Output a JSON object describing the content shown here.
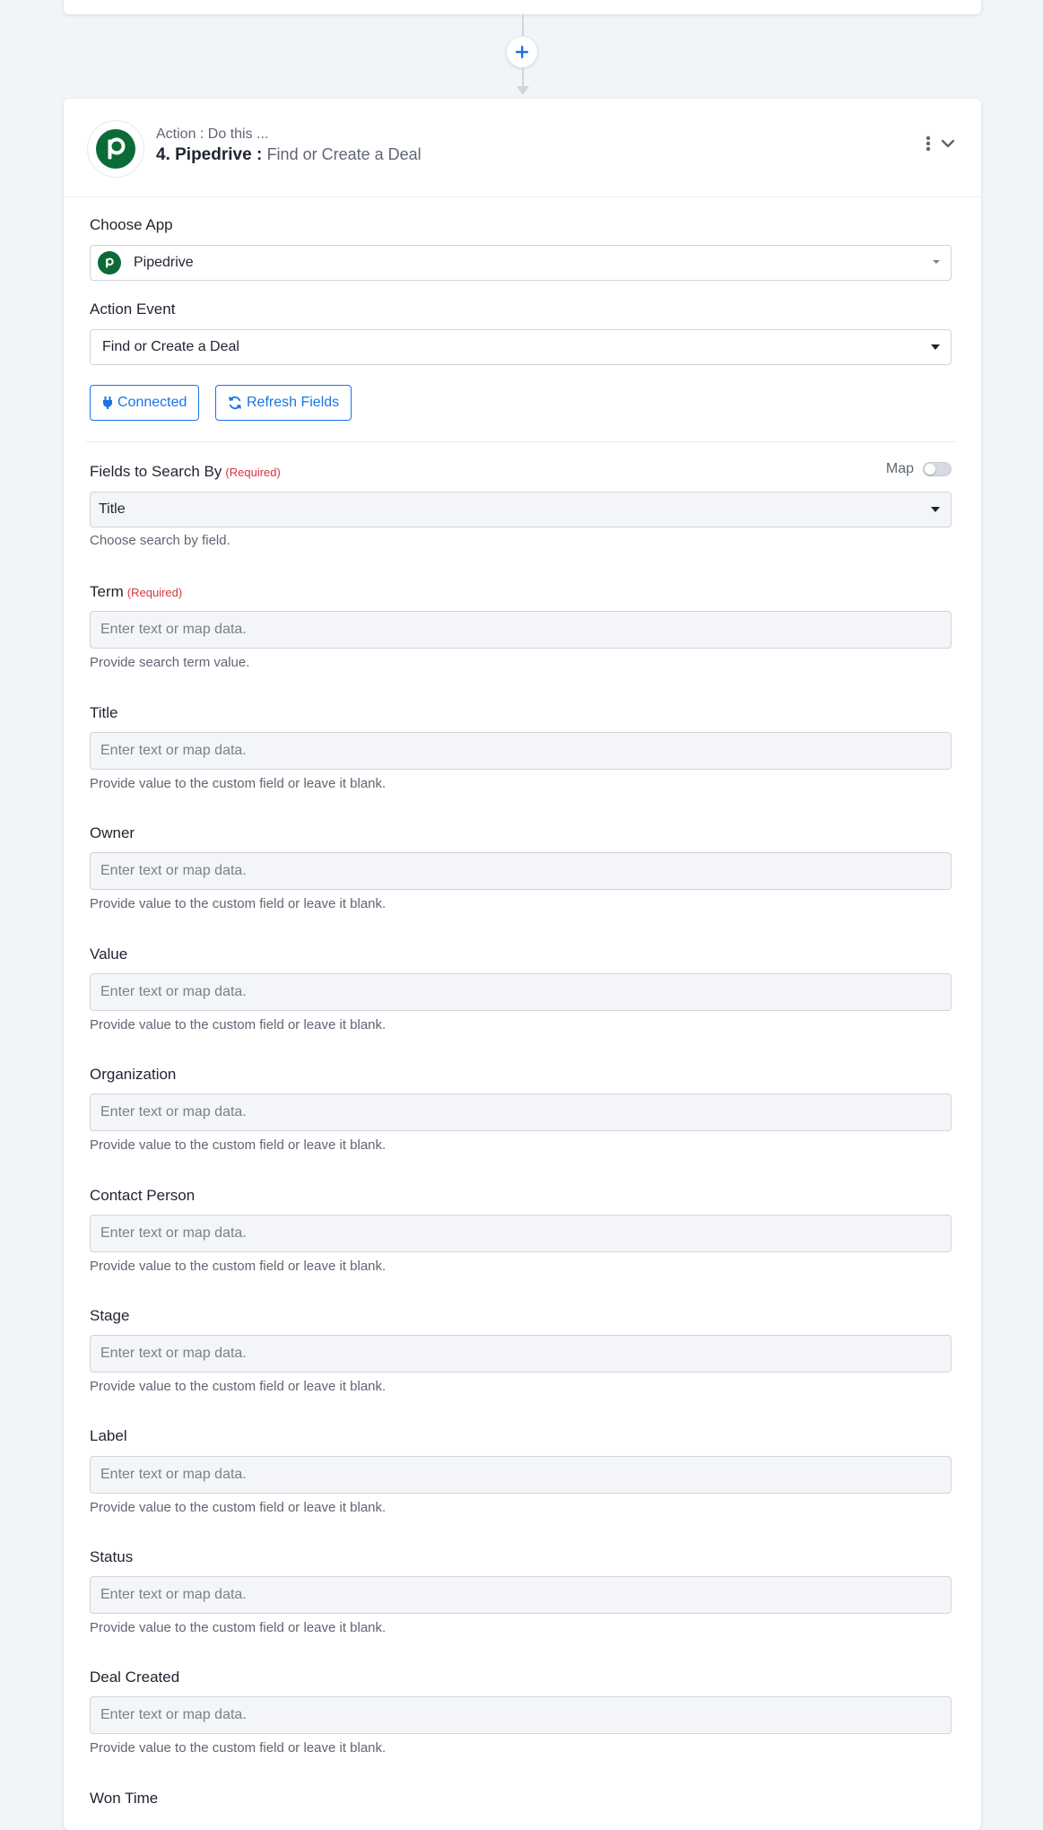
{
  "header": {
    "subtitle": "Action : Do this ...",
    "step": "4. Pipedrive :",
    "event": "Find or Create a Deal"
  },
  "choose_app": {
    "label": "Choose App",
    "value": "Pipedrive"
  },
  "action_event": {
    "label": "Action Event",
    "value": "Find or Create a Deal"
  },
  "buttons": {
    "connected": "Connected",
    "refresh": "Refresh Fields"
  },
  "search_by": {
    "label": "Fields to Search By",
    "required": "(Required)",
    "map_label": "Map",
    "value": "Title",
    "hint": "Choose search by field."
  },
  "term": {
    "label": "Term",
    "required": "(Required)",
    "placeholder": "Enter text or map data.",
    "hint": "Provide search term value."
  },
  "fields": [
    {
      "label": "Title",
      "placeholder": "Enter text or map data.",
      "hint": "Provide value to the custom field or leave it blank."
    },
    {
      "label": "Owner",
      "placeholder": "Enter text or map data.",
      "hint": "Provide value to the custom field or leave it blank."
    },
    {
      "label": "Value",
      "placeholder": "Enter text or map data.",
      "hint": "Provide value to the custom field or leave it blank."
    },
    {
      "label": "Organization",
      "placeholder": "Enter text or map data.",
      "hint": "Provide value to the custom field or leave it blank."
    },
    {
      "label": "Contact Person",
      "placeholder": "Enter text or map data.",
      "hint": "Provide value to the custom field or leave it blank."
    },
    {
      "label": "Stage",
      "placeholder": "Enter text or map data.",
      "hint": "Provide value to the custom field or leave it blank."
    },
    {
      "label": "Label",
      "placeholder": "Enter text or map data.",
      "hint": "Provide value to the custom field or leave it blank."
    },
    {
      "label": "Status",
      "placeholder": "Enter text or map data.",
      "hint": "Provide value to the custom field or leave it blank."
    },
    {
      "label": "Deal Created",
      "placeholder": "Enter text or map data.",
      "hint": "Provide value to the custom field or leave it blank."
    },
    {
      "label": "Won Time"
    }
  ],
  "colors": {
    "accent": "#1a73e8",
    "pipedrive_green": "#0b6b36",
    "required_red": "#d6323f"
  }
}
